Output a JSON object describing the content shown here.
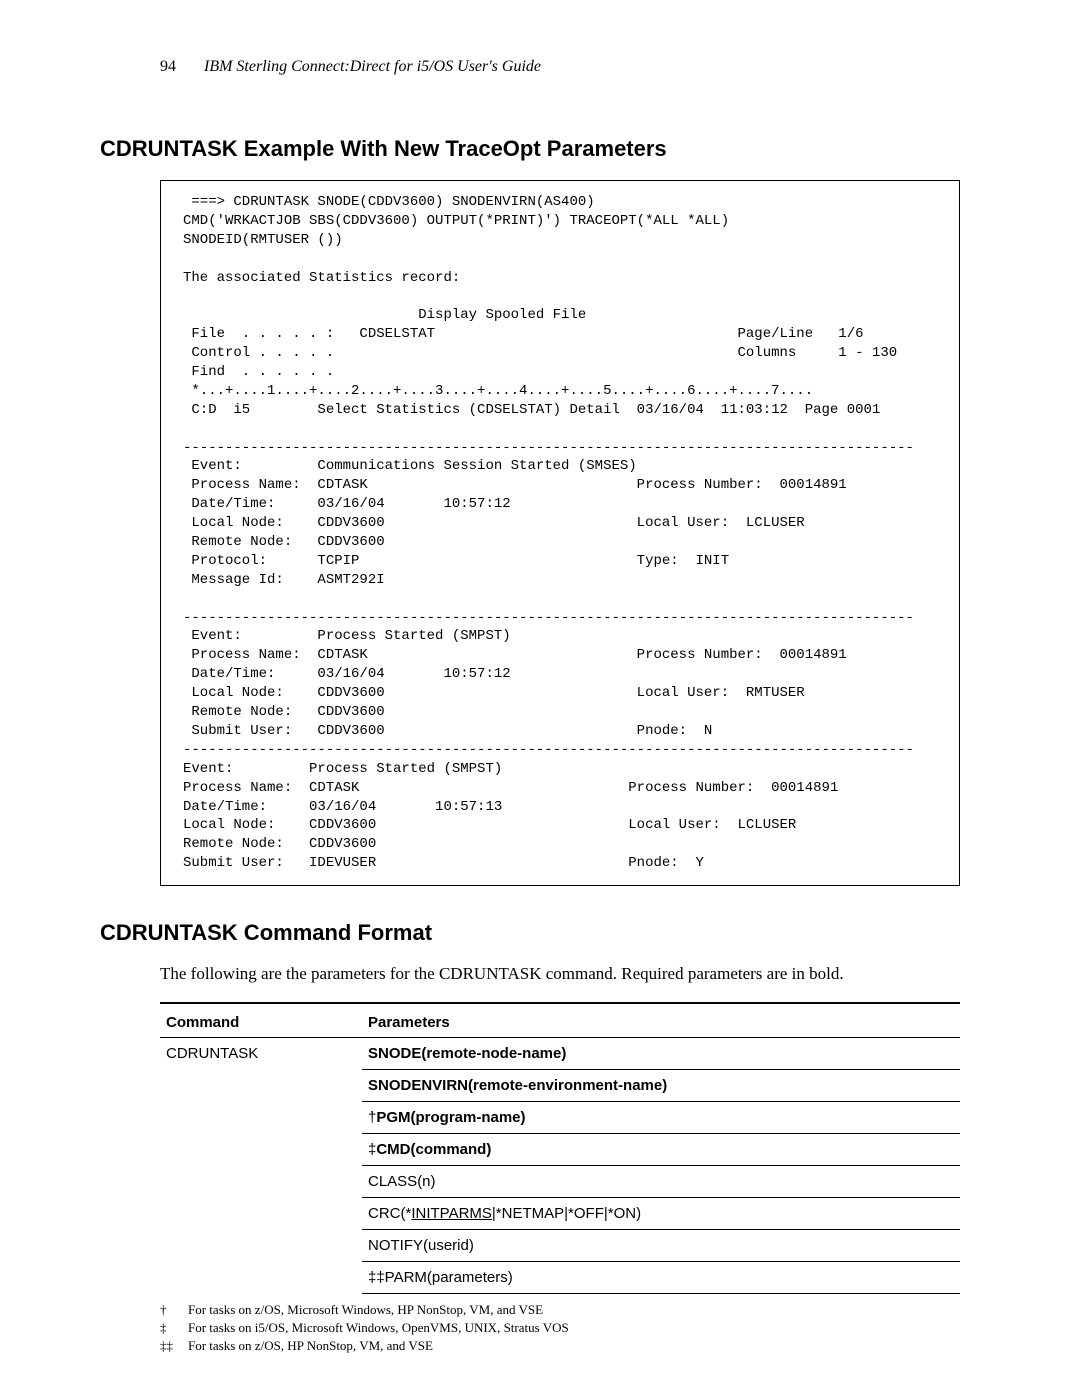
{
  "header": {
    "page_number": "94",
    "book_title": "IBM Sterling Connect:Direct for i5/OS User's Guide"
  },
  "section1": {
    "title": "CDRUNTASK Example With New TraceOpt Parameters",
    "code": " ===> CDRUNTASK SNODE(CDDV3600) SNODENVIRN(AS400)\nCMD('WRKACTJOB SBS(CDDV3600) OUTPUT(*PRINT)') TRACEOPT(*ALL *ALL)\nSNODEID(RMTUSER ())\n\nThe associated Statistics record:\n\n                            Display Spooled File\n File  . . . . . :   CDSELSTAT                                    Page/Line   1/6\n Control . . . . .                                                Columns     1 - 130\n Find  . . . . . .\n *...+....1....+....2....+....3....+....4....+....5....+....6....+....7....\n C:D  i5        Select Statistics (CDSELSTAT) Detail  03/16/04  11:03:12  Page 0001\n\n---------------------------------------------------------------------------------------\n Event:         Communications Session Started (SMSES)\n Process Name:  CDTASK                                Process Number:  00014891\n Date/Time:     03/16/04       10:57:12\n Local Node:    CDDV3600                              Local User:  LCLUSER\n Remote Node:   CDDV3600\n Protocol:      TCPIP                                 Type:  INIT\n Message Id:    ASMT292I\n\n---------------------------------------------------------------------------------------\n Event:         Process Started (SMPST)\n Process Name:  CDTASK                                Process Number:  00014891\n Date/Time:     03/16/04       10:57:12\n Local Node:    CDDV3600                              Local User:  RMTUSER\n Remote Node:   CDDV3600\n Submit User:   CDDV3600                              Pnode:  N\n---------------------------------------------------------------------------------------\nEvent:         Process Started (SMPST)\nProcess Name:  CDTASK                                Process Number:  00014891\nDate/Time:     03/16/04       10:57:13\nLocal Node:    CDDV3600                              Local User:  LCLUSER\nRemote Node:   CDDV3600\nSubmit User:   IDEVUSER                              Pnode:  Y"
  },
  "section2": {
    "title": "CDRUNTASK Command Format",
    "intro": "The following are the parameters for the CDRUNTASK command. Required parameters are in bold.",
    "table": {
      "head_command": "Command",
      "head_parameters": "Parameters",
      "command_name": "CDRUNTASK",
      "rows": [
        {
          "html": "<span class='bold'>SNODE(remote-node-name)</span>"
        },
        {
          "html": "<span class='bold'>SNODENVIRN(remote-environment-name)</span>"
        },
        {
          "html": "&#8224;<span class='bold'>PGM(program-name)</span>"
        },
        {
          "html": "&#8225;<span class='bold'>CMD(command)</span>"
        },
        {
          "html": "CLASS(n)"
        },
        {
          "html": "CRC(*<span class='inner-underline'>INITPARMS</span>|*NETMAP|*OFF|*ON)"
        },
        {
          "html": "NOTIFY(userid)"
        },
        {
          "html": "&#8225;&#8225;PARM(parameters)"
        }
      ]
    },
    "footnotes": [
      {
        "symbol": "†",
        "text": "For tasks on z/OS, Microsoft Windows, HP NonStop, VM, and VSE"
      },
      {
        "symbol": "‡",
        "text": "For tasks on i5/OS, Microsoft Windows, OpenVMS, UNIX, Stratus VOS"
      },
      {
        "symbol": "‡‡",
        "text": "For tasks on z/OS, HP NonStop, VM, and VSE"
      }
    ]
  }
}
